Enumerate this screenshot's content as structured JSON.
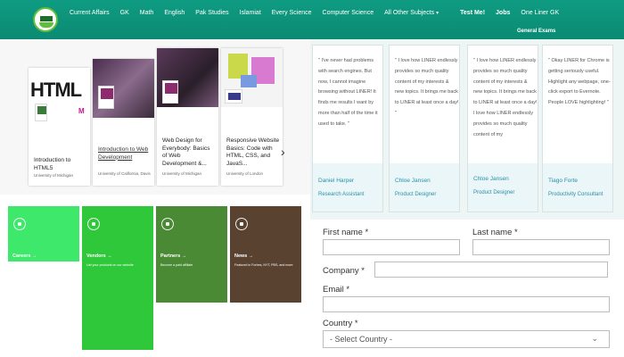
{
  "nav": {
    "items": [
      "Current Affairs",
      "GK",
      "Math",
      "English",
      "Pak Studies",
      "Islamiat",
      "Every Science",
      "Computer Science",
      "All Other Subjects"
    ],
    "caret": "▾",
    "bold_items": [
      "Test Me!",
      "Jobs",
      "One Liner GK"
    ],
    "second_row": "General Exams"
  },
  "courses": [
    {
      "title": "Introduction to HTML5",
      "university": "University of Michigan",
      "thumb": "HTML",
      "badge": "M"
    },
    {
      "title": "Introduction to Web Development",
      "university": "University of California, Davis",
      "badge": "M"
    },
    {
      "title": "Web Design for Everybody: Basics of Web Development &...",
      "university": "University of Michigan",
      "badge": "M"
    },
    {
      "title": "Responsive Website Basics: Code with HTML, CSS, and JavaS...",
      "university": "University of London"
    }
  ],
  "next_icon": "›",
  "testimonials": [
    {
      "quote": "\" I've never had problems with search engines. But now, I cannot imagine browsing without LINER! It finds me results I want by more than half of the time it used to take. \"",
      "name": "Daniel Harper",
      "role": "Research Assistant"
    },
    {
      "quote": "\" I love how LINER endlessly provides so much quality content of my interests & new topics. It brings me back to LINER at least once a day! \"",
      "name": "Chloe Jansen",
      "role": "Product Designer"
    },
    {
      "quote": "\" I love how LINER endlessly provides so much quality content of my interests & new topics. It brings me back to LINER at least once a day! I love how LINER endlessly provides so much quality content of my",
      "name": "Chloe Jansen",
      "role": "Product Designer"
    },
    {
      "quote": "\" Okay LINER for Chrome is getting seriously useful. Highlight any webpage, one-click export to Evernote. People LOVE highlighting! \"",
      "name": "Tiago Forte",
      "role": "Productivity Consultant"
    }
  ],
  "tiles": [
    {
      "label": "Careers →",
      "desc": "Join the Kicker of Trello Work & world of opportunities",
      "color": "#3ee86a"
    },
    {
      "label": "Vendors →",
      "desc": "List your products on our website",
      "color": "#2fc83b"
    },
    {
      "label": "Partners →",
      "desc": "Become a paid affiliate",
      "color": "#4a8a35"
    },
    {
      "label": "News →",
      "desc": "Featured in Forbes, NYT, PBS, and more",
      "color": "#5a4230"
    }
  ],
  "form": {
    "first_name_label": "First name *",
    "last_name_label": "Last name *",
    "company_label": "Company *",
    "email_label": "Email *",
    "country_label": "Country *",
    "country_value": "- Select Country -",
    "chevron_icon": "⌄"
  }
}
